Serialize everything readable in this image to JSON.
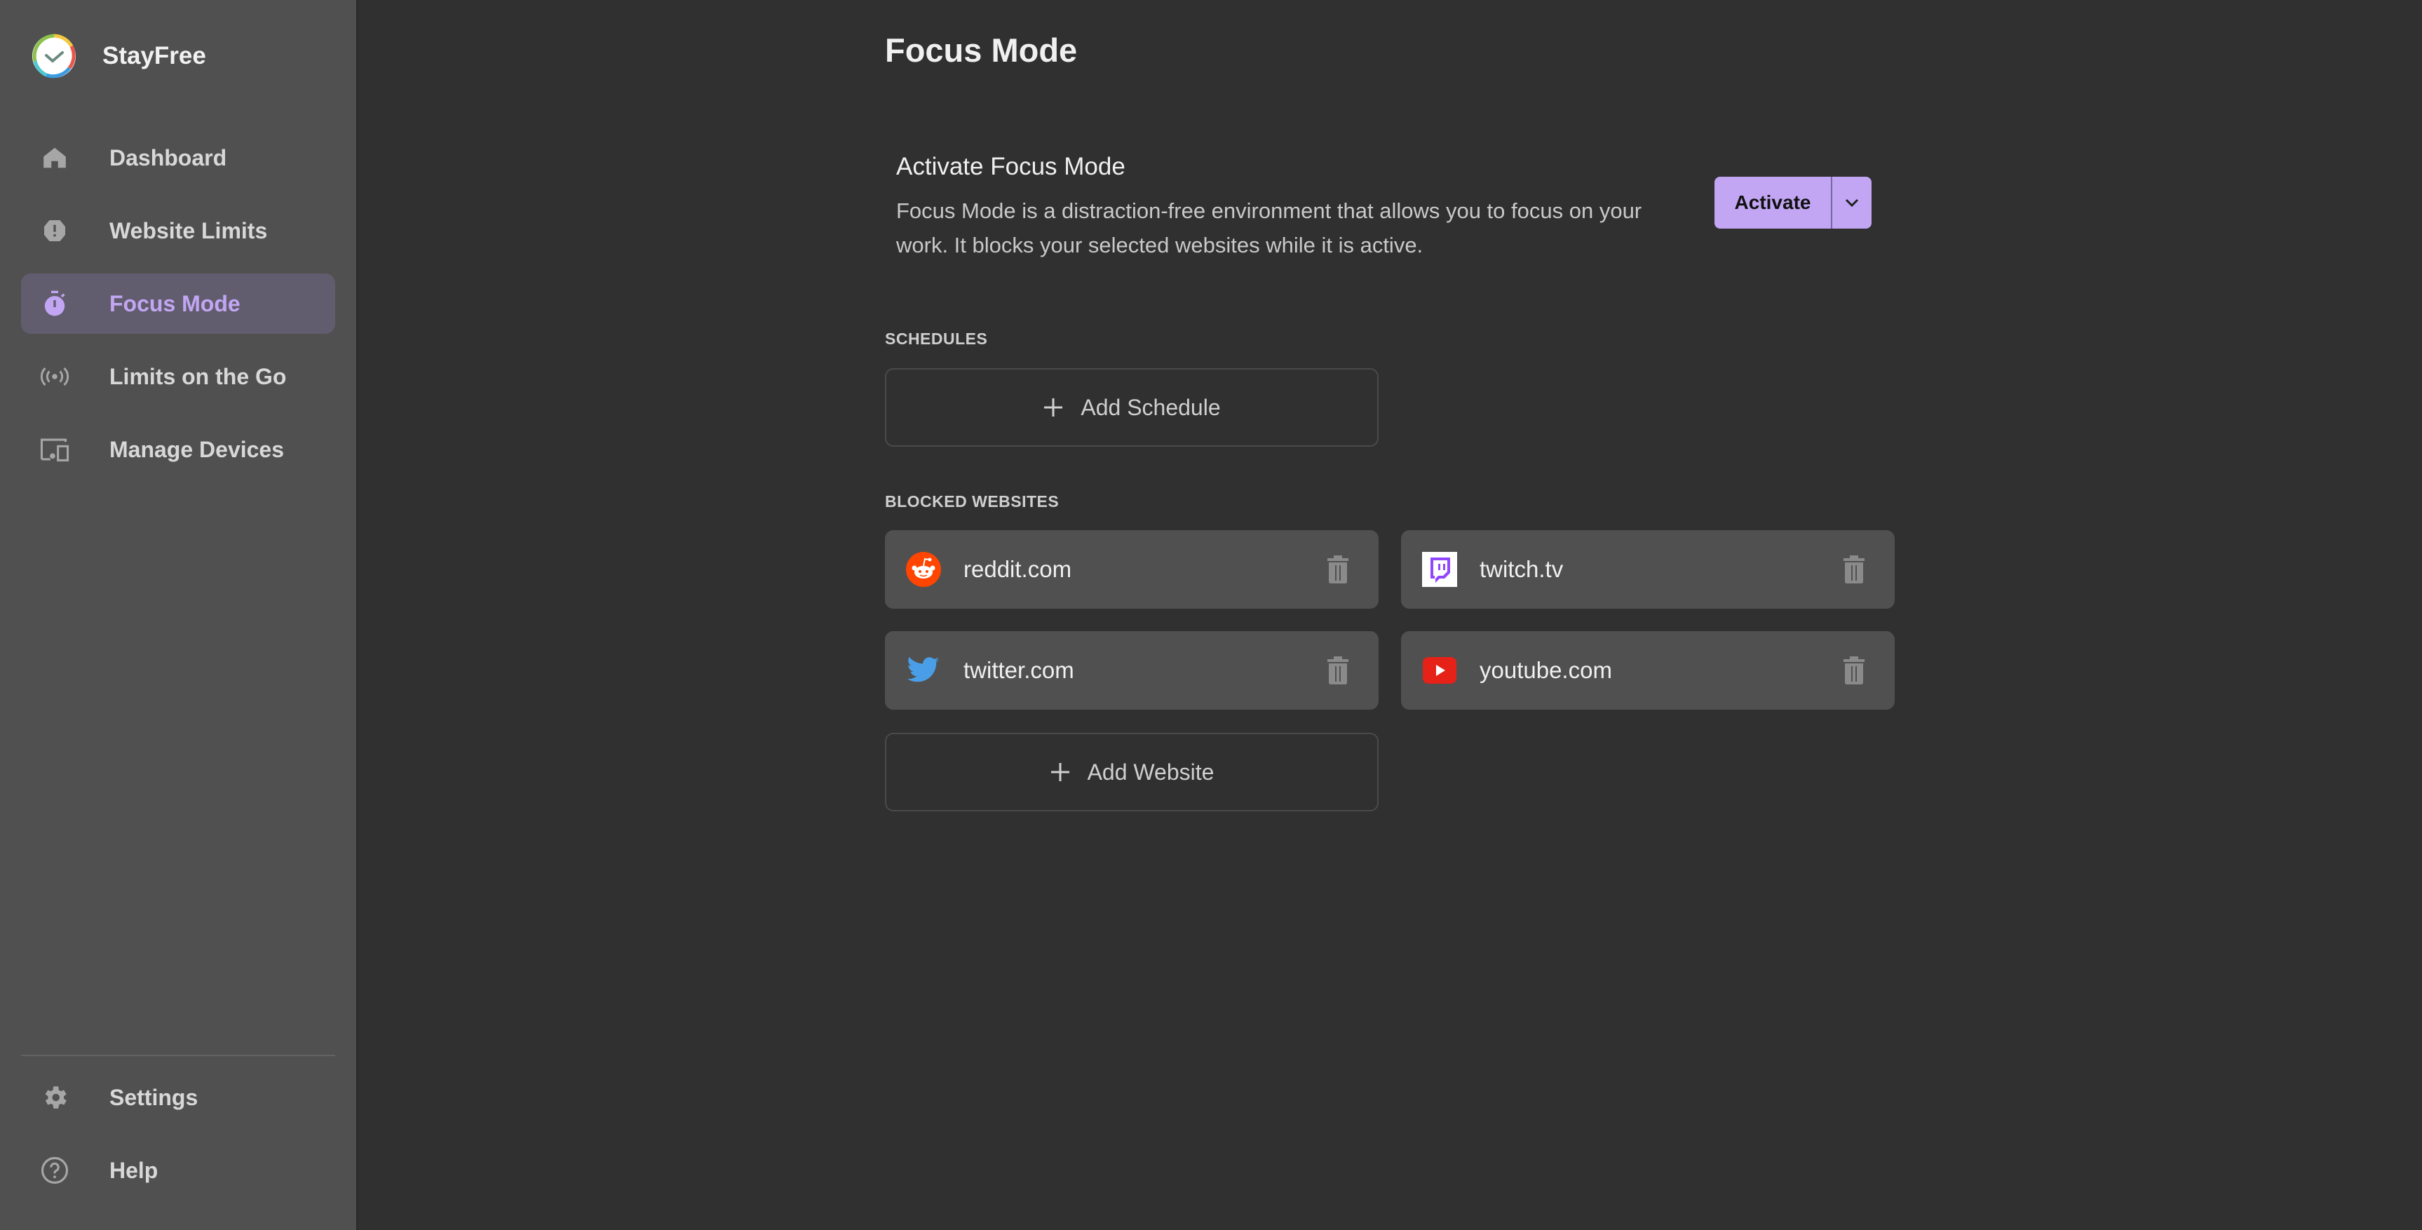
{
  "app": {
    "name": "StayFree",
    "logo_icon": "stayfree-clock-logo"
  },
  "sidebar": {
    "items": [
      {
        "label": "Dashboard",
        "icon": "home-icon",
        "active": false
      },
      {
        "label": "Website Limits",
        "icon": "alert-octagon-icon",
        "active": false
      },
      {
        "label": "Focus Mode",
        "icon": "timer-icon",
        "active": true
      },
      {
        "label": "Limits on the Go",
        "icon": "broadcast-icon",
        "active": false
      },
      {
        "label": "Manage Devices",
        "icon": "devices-icon",
        "active": false
      }
    ],
    "bottom_items": [
      {
        "label": "Settings",
        "icon": "gear-icon"
      },
      {
        "label": "Help",
        "icon": "help-circle-icon"
      }
    ]
  },
  "page": {
    "title": "Focus Mode",
    "activate": {
      "title": "Activate Focus Mode",
      "description": "Focus Mode is a distraction-free environment that allows you to focus on your work. It blocks your selected websites while it is active.",
      "button_label": "Activate",
      "dropdown_icon": "chevron-down-icon"
    },
    "schedules": {
      "label": "SCHEDULES",
      "add_label": "Add Schedule"
    },
    "blocked": {
      "label": "BLOCKED WEBSITES",
      "sites": [
        {
          "name": "reddit.com",
          "icon": "reddit-icon"
        },
        {
          "name": "twitch.tv",
          "icon": "twitch-icon"
        },
        {
          "name": "twitter.com",
          "icon": "twitter-icon"
        },
        {
          "name": "youtube.com",
          "icon": "youtube-icon"
        }
      ],
      "add_label": "Add Website"
    }
  },
  "colors": {
    "accent": "#c2a6f3",
    "sidebar_bg": "#505050",
    "main_bg": "#303030",
    "active_item_bg": "#625d6e",
    "card_bg": "#505050"
  }
}
